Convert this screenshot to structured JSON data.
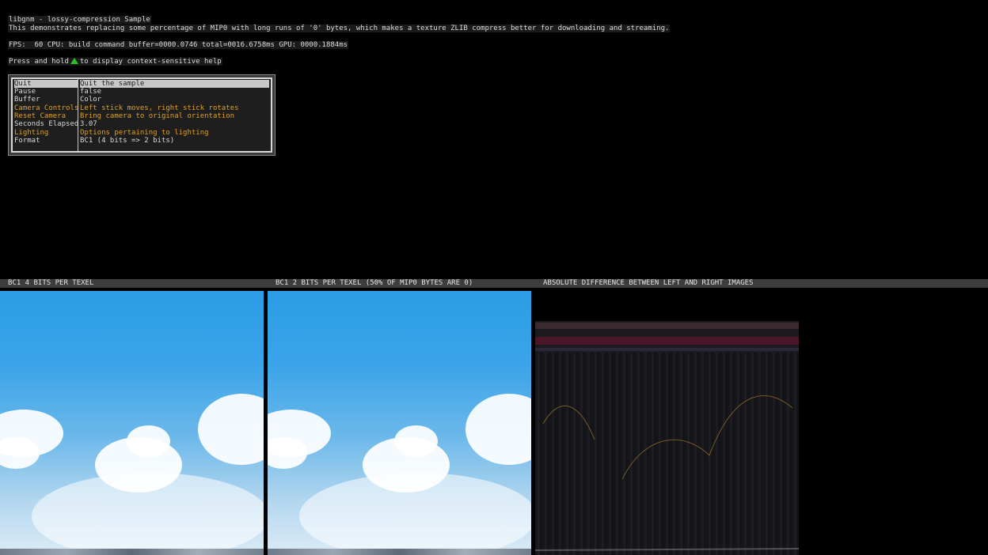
{
  "header": {
    "line1": "libgnm - lossy-compression Sample",
    "line2": "This demonstrates replacing some percentage of MIP0 with long runs of '0' bytes, which makes a texture ZLIB compress better for downloading and streaming.",
    "perf": "FPS:  60 CPU: build command buffer=0000.0746 total=0016.6758ms GPU: 0000.1884ms",
    "help_prefix": "Press and hold",
    "help_suffix": "to display context-sensitive help",
    "help_icon": "triangle-button-icon"
  },
  "menu": {
    "items": [
      {
        "label": "Quit",
        "value": "Quit the sample"
      },
      {
        "label": "Pause",
        "value": "false"
      },
      {
        "label": "Buffer",
        "value": "Color"
      },
      {
        "label": "Camera Controls",
        "value": "Left stick moves, right stick rotates"
      },
      {
        "label": "Reset Camera",
        "value": "Bring camera to original orientation"
      },
      {
        "label": "Seconds Elapsed",
        "value": "3.07"
      },
      {
        "label": "Lighting",
        "value": "Options pertaining to lighting"
      },
      {
        "label": "Format",
        "value": "BC1 (4 bits => 2 bits)"
      }
    ]
  },
  "panels": {
    "left_label": "BC1 4 BITS PER TEXEL",
    "middle_label": "BC1 2 BITS PER TEXEL (50% OF MIP0 BYTES ARE 0)",
    "right_label": "ABSOLUTE DIFFERENCE BETWEEN LEFT AND RIGHT IMAGES"
  },
  "colors": {
    "accent_orange": "#e0a020",
    "help_triangle": "#2fbf2f",
    "sky_top": "#2b9de6"
  }
}
